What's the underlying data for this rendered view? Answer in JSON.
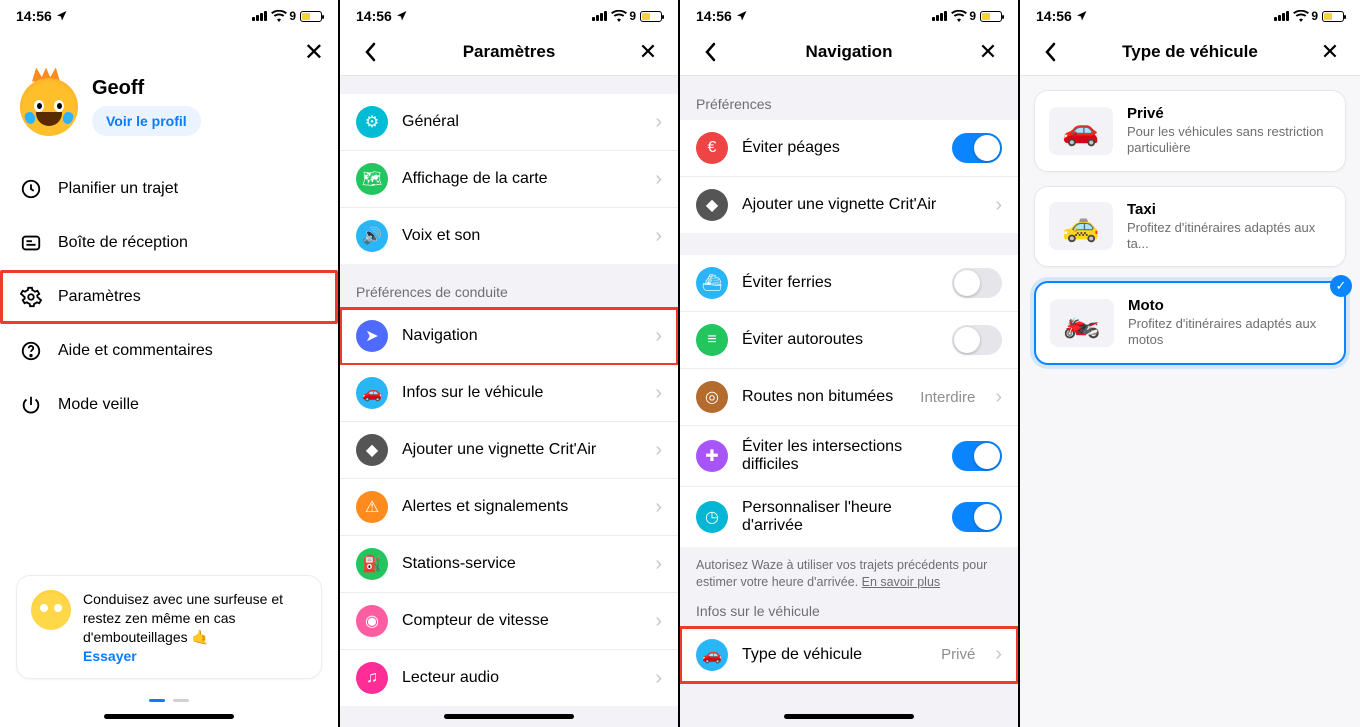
{
  "status": {
    "time": "14:56",
    "battery": "9"
  },
  "s1": {
    "name": "Geoff",
    "view_profile": "Voir le profil",
    "menu": [
      {
        "label": "Planifier un trajet"
      },
      {
        "label": "Boîte de réception"
      },
      {
        "label": "Paramètres"
      },
      {
        "label": "Aide et commentaires"
      },
      {
        "label": "Mode veille"
      }
    ],
    "promo": "Conduisez avec une surfeuse et restez zen même en cas d'embouteillages 🤙",
    "promo_try": "Essayer"
  },
  "s2": {
    "title": "Paramètres",
    "group1": [
      {
        "label": "Général",
        "color": "#00bcd4",
        "glyph": "⚙"
      },
      {
        "label": "Affichage de la carte",
        "color": "#22c55e",
        "glyph": "🗺"
      },
      {
        "label": "Voix et son",
        "color": "#29b6f6",
        "glyph": "🔊"
      }
    ],
    "sect2": "Préférences de conduite",
    "group2": [
      {
        "label": "Navigation",
        "color": "#4f6bff",
        "glyph": "➤"
      },
      {
        "label": "Infos sur le véhicule",
        "color": "#29b6f6",
        "glyph": "🚗"
      },
      {
        "label": "Ajouter une vignette Crit'Air",
        "color": "#555555",
        "glyph": "◆"
      },
      {
        "label": "Alertes et signalements",
        "color": "#ff8a1e",
        "glyph": "⚠"
      },
      {
        "label": "Stations-service",
        "color": "#22c55e",
        "glyph": "⛽"
      },
      {
        "label": "Compteur de vitesse",
        "color": "#ff5da2",
        "glyph": "◉"
      },
      {
        "label": "Lecteur audio",
        "color": "#ff2d95",
        "glyph": "♫"
      }
    ]
  },
  "s3": {
    "title": "Navigation",
    "sect1": "Préférences",
    "rows1": [
      {
        "label": "Éviter péages",
        "color": "#ef4444",
        "glyph": "€",
        "type": "toggle",
        "on": true
      },
      {
        "label": "Ajouter une vignette Crit'Air",
        "color": "#555555",
        "glyph": "◆",
        "type": "chev"
      }
    ],
    "rows2": [
      {
        "label": "Éviter ferries",
        "color": "#29b6f6",
        "glyph": "⛴",
        "type": "toggle",
        "on": false
      },
      {
        "label": "Éviter autoroutes",
        "color": "#22c55e",
        "glyph": "≡",
        "type": "toggle",
        "on": false
      },
      {
        "label": "Routes non bitumées",
        "color": "#b36b2e",
        "glyph": "◎",
        "type": "value",
        "val": "Interdire"
      },
      {
        "label": "Éviter les intersections difficiles",
        "color": "#a855f7",
        "glyph": "✚",
        "type": "toggle",
        "on": true
      },
      {
        "label": "Personnaliser l'heure d'arrivée",
        "color": "#06b6d4",
        "glyph": "◷",
        "type": "toggle",
        "on": true
      }
    ],
    "footnote": "Autorisez Waze à utiliser vos trajets précédents pour estimer votre heure d'arrivée. ",
    "footlink": "En savoir plus",
    "sect2": "Infos sur le véhicule",
    "rows3": [
      {
        "label": "Type de véhicule",
        "color": "#29b6f6",
        "glyph": "🚗",
        "type": "value",
        "val": "Privé"
      }
    ]
  },
  "s4": {
    "title": "Type de véhicule",
    "cards": [
      {
        "title": "Privé",
        "sub": "Pour les véhicules sans restriction particulière",
        "glyph": "🚗",
        "sel": false
      },
      {
        "title": "Taxi",
        "sub": "Profitez d'itinéraires adaptés aux ta...",
        "glyph": "🚕",
        "sel": false
      },
      {
        "title": "Moto",
        "sub": "Profitez d'itinéraires adaptés aux motos",
        "glyph": "🏍️",
        "sel": true
      }
    ]
  }
}
